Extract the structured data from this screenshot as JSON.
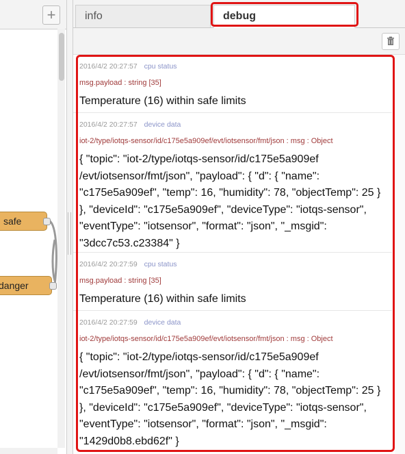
{
  "canvas": {
    "add_label": "+",
    "nodes": {
      "safe": "safe",
      "danger": "danger"
    }
  },
  "tabs": {
    "info": "info",
    "debug": "debug"
  },
  "toolbar": {
    "clear_icon": "trash-icon"
  },
  "messages": [
    {
      "timestamp": "2016/4/2 20:27:57",
      "source": "cpu status",
      "topic": "msg.payload : string [35]",
      "payload": "Temperature (16) within safe limits"
    },
    {
      "timestamp": "2016/4/2 20:27:57",
      "source": "device data",
      "topic": "iot-2/type/iotqs-sensor/id/c175e5a909ef/evt/iotsensor/fmt/json : msg : Object",
      "payload": "{ \"topic\": \"iot-2/type/iotqs-sensor/id/c175e5a909ef /evt/iotsensor/fmt/json\", \"payload\": { \"d\": { \"name\": \"c175e5a909ef\", \"temp\": 16, \"humidity\": 78, \"objectTemp\": 25 } }, \"deviceId\": \"c175e5a909ef\", \"deviceType\": \"iotqs-sensor\", \"eventType\": \"iotsensor\", \"format\": \"json\", \"_msgid\": \"3dcc7c53.c23384\" }"
    },
    {
      "timestamp": "2016/4/2 20:27:59",
      "source": "cpu status",
      "topic": "msg.payload : string [35]",
      "payload": "Temperature (16) within safe limits"
    },
    {
      "timestamp": "2016/4/2 20:27:59",
      "source": "device data",
      "topic": "iot-2/type/iotqs-sensor/id/c175e5a909ef/evt/iotsensor/fmt/json : msg : Object",
      "payload": "{ \"topic\": \"iot-2/type/iotqs-sensor/id/c175e5a909ef /evt/iotsensor/fmt/json\", \"payload\": { \"d\": { \"name\": \"c175e5a909ef\", \"temp\": 16, \"humidity\": 78, \"objectTemp\": 25 } }, \"deviceId\": \"c175e5a909ef\", \"deviceType\": \"iotqs-sensor\", \"eventType\": \"iotsensor\", \"format\": \"json\", \"_msgid\": \"1429d0b8.ebd62f\" }"
    }
  ]
}
